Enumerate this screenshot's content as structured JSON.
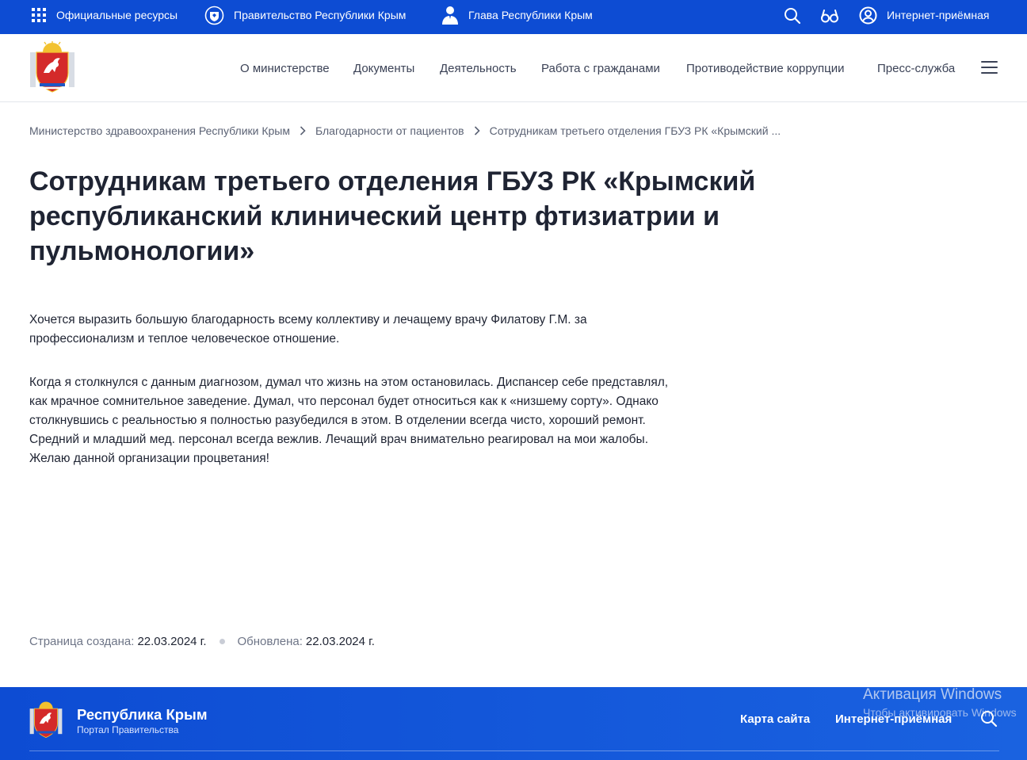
{
  "topbar": {
    "official_resources": "Официальные ресурсы",
    "government": "Правительство Республики Крым",
    "head": "Глава Республики Крым",
    "reception": "Интернет-приёмная",
    "icons": [
      "apps-grid-icon",
      "government-emblem-icon",
      "person-icon",
      "search-icon",
      "glasses-icon",
      "user-icon"
    ]
  },
  "nav": {
    "items": [
      "О министерстве",
      "Документы",
      "Деятельность",
      "Работа с гражданами",
      "Противодействие коррупции",
      "Пресс-служба"
    ]
  },
  "breadcrumb": {
    "items": [
      "Министерство здравоохранения Республики Крым",
      "Благодарности от пациентов",
      "Сотрудникам третьего отделения ГБУЗ РК «Крымский ..."
    ]
  },
  "article": {
    "title_line1": "Сотрудникам третьего отделения ГБУЗ РК «Крымский",
    "title_line2": "республиканский клинический центр фтизиатрии и",
    "title_line3": "пульмонологии»",
    "p1_line1": "Хочется выразить большую благодарность всему коллективу и лечащему врачу Филатову Г.М. за",
    "p1_line2": "профессионализм и теплое человеческое отношение.",
    "p2_line1": "Когда я столкнулся с данным диагнозом, думал что жизнь на этом остановилась. Диспансер себе представлял,",
    "p2_line2": "как мрачное сомнительное заведение. Думал, что персонал будет относиться как к «низшему сорту». Однако",
    "p2_line3": "столкнувшись с реальностью я полностью разубедился в этом. В отделении всегда чисто, хороший ремонт.",
    "p2_line4": "Средний и младший мед. персонал всегда вежлив. Лечащий врач внимательно реагировал на мои жалобы.",
    "p2_line5": "Желаю данной организации процветания!"
  },
  "meta": {
    "created_label": "Страница создана:",
    "created_value": "22.03.2024 г.",
    "updated_label": "Обновлена:",
    "updated_value": "22.03.2024 г."
  },
  "footer": {
    "title": "Республика Крым",
    "subtitle": "Портал Правительства",
    "sitemap": "Карта сайта",
    "reception": "Интернет-приёмная"
  },
  "watermark": {
    "line1": "Активация Windows",
    "line2": "Чтобы активировать Windows"
  },
  "colors": {
    "brand_blue": "#0d4cd3",
    "text_dark": "#1f2433",
    "text_muted": "#6e7587"
  }
}
